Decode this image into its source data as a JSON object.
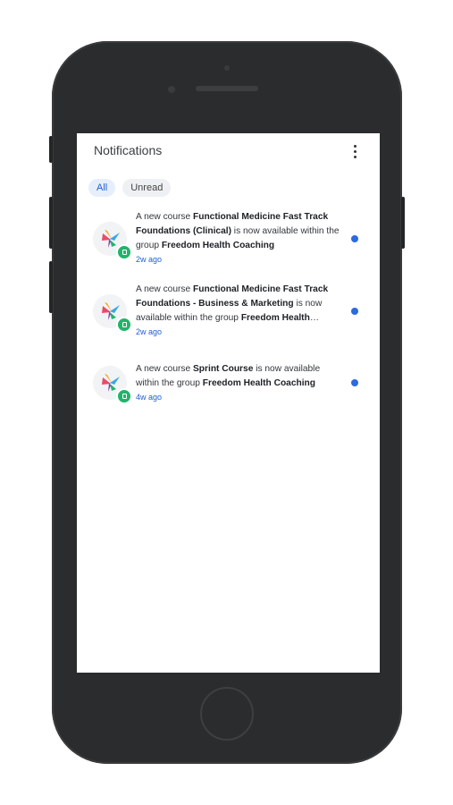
{
  "header": {
    "title": "Notifications",
    "menu_icon": "more-vertical-icon"
  },
  "filters": [
    {
      "label": "All",
      "selected": true
    },
    {
      "label": "Unread",
      "selected": false
    }
  ],
  "notifications": [
    {
      "prefix": "A new course ",
      "course": "Functional Medicine Fast Track Foundations (Clinical)",
      "middle": " is now available within the group ",
      "group": "Freedom Health Coaching",
      "time": "2w ago",
      "unread": true
    },
    {
      "prefix": "A new course ",
      "course": "Functional Medicine Fast Track Foundations - Business & Marketing",
      "middle": " is now available within the group ",
      "group": "Freedom Health Coaching",
      "time": "2w ago",
      "unread": true
    },
    {
      "prefix": "A new course ",
      "course": "Sprint Course",
      "middle": " is now available within the group ",
      "group": "Freedom Health Coaching",
      "time": "4w ago",
      "unread": true
    }
  ],
  "colors": {
    "accent": "#2b6ae0",
    "badge": "#21b36b",
    "device": "#2b2c2e"
  }
}
